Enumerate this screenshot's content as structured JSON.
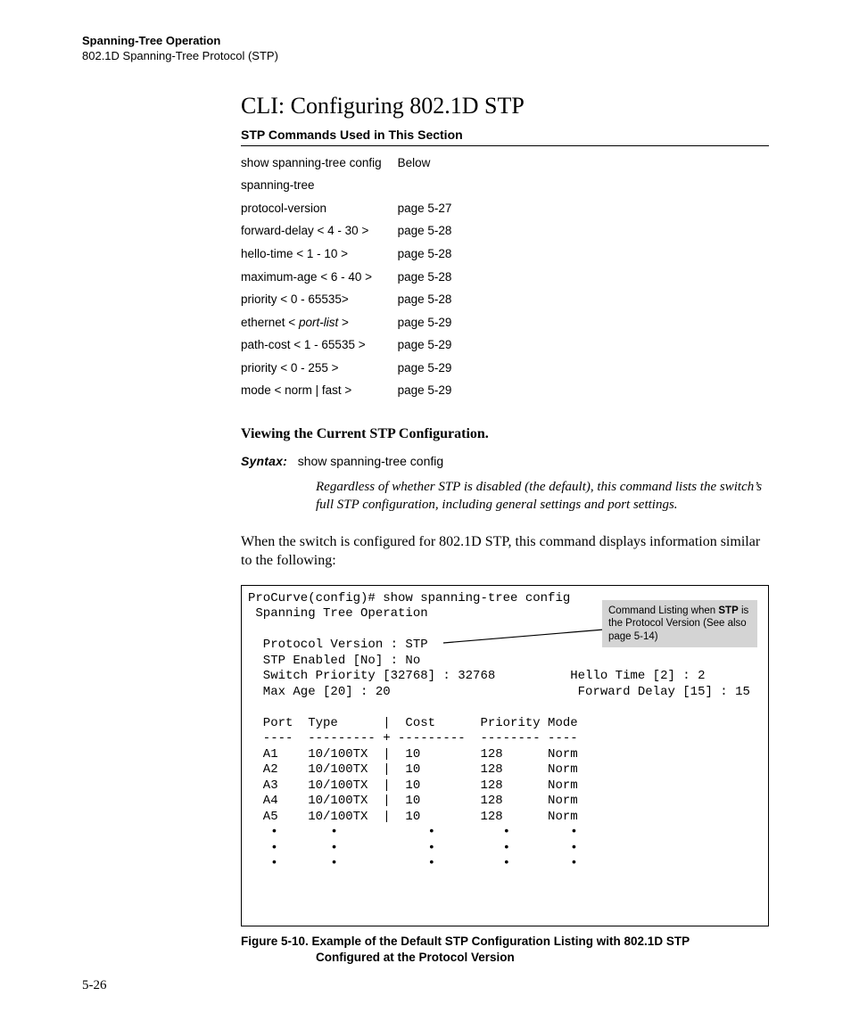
{
  "header": {
    "breadcrumb_bold": "Spanning-Tree Operation",
    "breadcrumb": "802.1D Spanning-Tree Protocol (STP)"
  },
  "title": "CLI: Configuring 802.1D STP",
  "section_label": "STP Commands Used in This Section",
  "commands": [
    {
      "indent": 0,
      "name": "show spanning-tree config",
      "page": "Below"
    },
    {
      "indent": 0,
      "name": "spanning-tree",
      "page": ""
    },
    {
      "indent": 1,
      "name": "protocol-version",
      "page": "page 5-27"
    },
    {
      "indent": 1,
      "name": "forward-delay < 4 - 30 >",
      "page": "page 5-28"
    },
    {
      "indent": 1,
      "name": "hello-time < 1 - 10 >",
      "page": "page 5-28"
    },
    {
      "indent": 1,
      "name": "maximum-age < 6 - 40 >",
      "page": "page 5-28"
    },
    {
      "indent": 1,
      "name": "priority < 0 - 65535>",
      "page": "page 5-28"
    },
    {
      "indent": 1,
      "name_pre": "ethernet < ",
      "name_it": "port-list",
      "name_post": " >",
      "page": "page 5-29"
    },
    {
      "indent": 2,
      "name": "path-cost < 1 - 65535 >",
      "page": "page 5-29"
    },
    {
      "indent": 2,
      "name": "priority < 0 - 255 >",
      "page": "page 5-29"
    },
    {
      "indent": 2,
      "name": "mode < norm | fast >",
      "page": "page 5-29"
    }
  ],
  "para_title": "Viewing the Current STP Configuration.",
  "syntax": {
    "label": "Syntax:",
    "command": "show spanning-tree config",
    "desc": "Regardless of whether STP is disabled (the default), this command lists the switch’s full STP configuration, including general settings and port settings."
  },
  "body_para": "When the switch is configured for 802.1D STP, this command displays information similar to the following:",
  "terminal": {
    "prompt": "ProCurve(config)# show spanning-tree config",
    "heading": " Spanning Tree Operation",
    "protocol_version": "  Protocol Version : STP",
    "stp_enabled": "  STP Enabled [No] : No",
    "switch_prio_line": "  Switch Priority [32768] : 32768          Hello Time [2] : 2",
    "maxage_line": "  Max Age [20] : 20                         Forward Delay [15] : 15",
    "table_head": "  Port  Type      |  Cost      Priority Mode",
    "table_sep": "  ----  --------- + ---------  -------- ----",
    "rows": [
      "  A1    10/100TX  |  10        128      Norm",
      "  A2    10/100TX  |  10        128      Norm",
      "  A3    10/100TX  |  10        128      Norm",
      "  A4    10/100TX  |  10        128      Norm",
      "  A5    10/100TX  |  10        128      Norm"
    ],
    "dots": [
      "   •       •            •         •        •",
      "   •       •            •         •        •",
      "   •       •            •         •        •"
    ],
    "callout_line1": "Command Listing when ",
    "callout_bold": "STP",
    "callout_line2": " is the Protocol Version (See also page 5-14)"
  },
  "figure_caption_l1": "Figure 5-10.  Example of the Default STP Configuration Listing with 802.1D STP",
  "figure_caption_l2": "Configured at the Protocol Version",
  "page_number": "5-26"
}
